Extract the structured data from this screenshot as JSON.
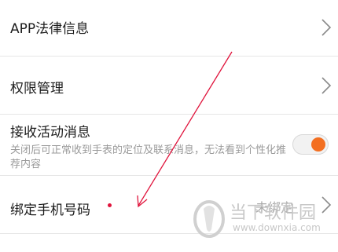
{
  "settings": {
    "items": [
      {
        "label": "APP法律信息"
      },
      {
        "label": "权限管理"
      },
      {
        "label": "接收活动消息",
        "description": "关闭后可正常收到手表的定位及联系消息，无法看到个性化推荐内容",
        "toggle_on": true
      },
      {
        "label": "绑定手机号码",
        "value": "未绑定"
      }
    ]
  },
  "watermark": {
    "brand": "当下软件园",
    "url": "www.downxia.com"
  },
  "colors": {
    "accent": "#f36f21",
    "annotation_arrow": "#e0143c",
    "divider": "#e6e6e6"
  }
}
